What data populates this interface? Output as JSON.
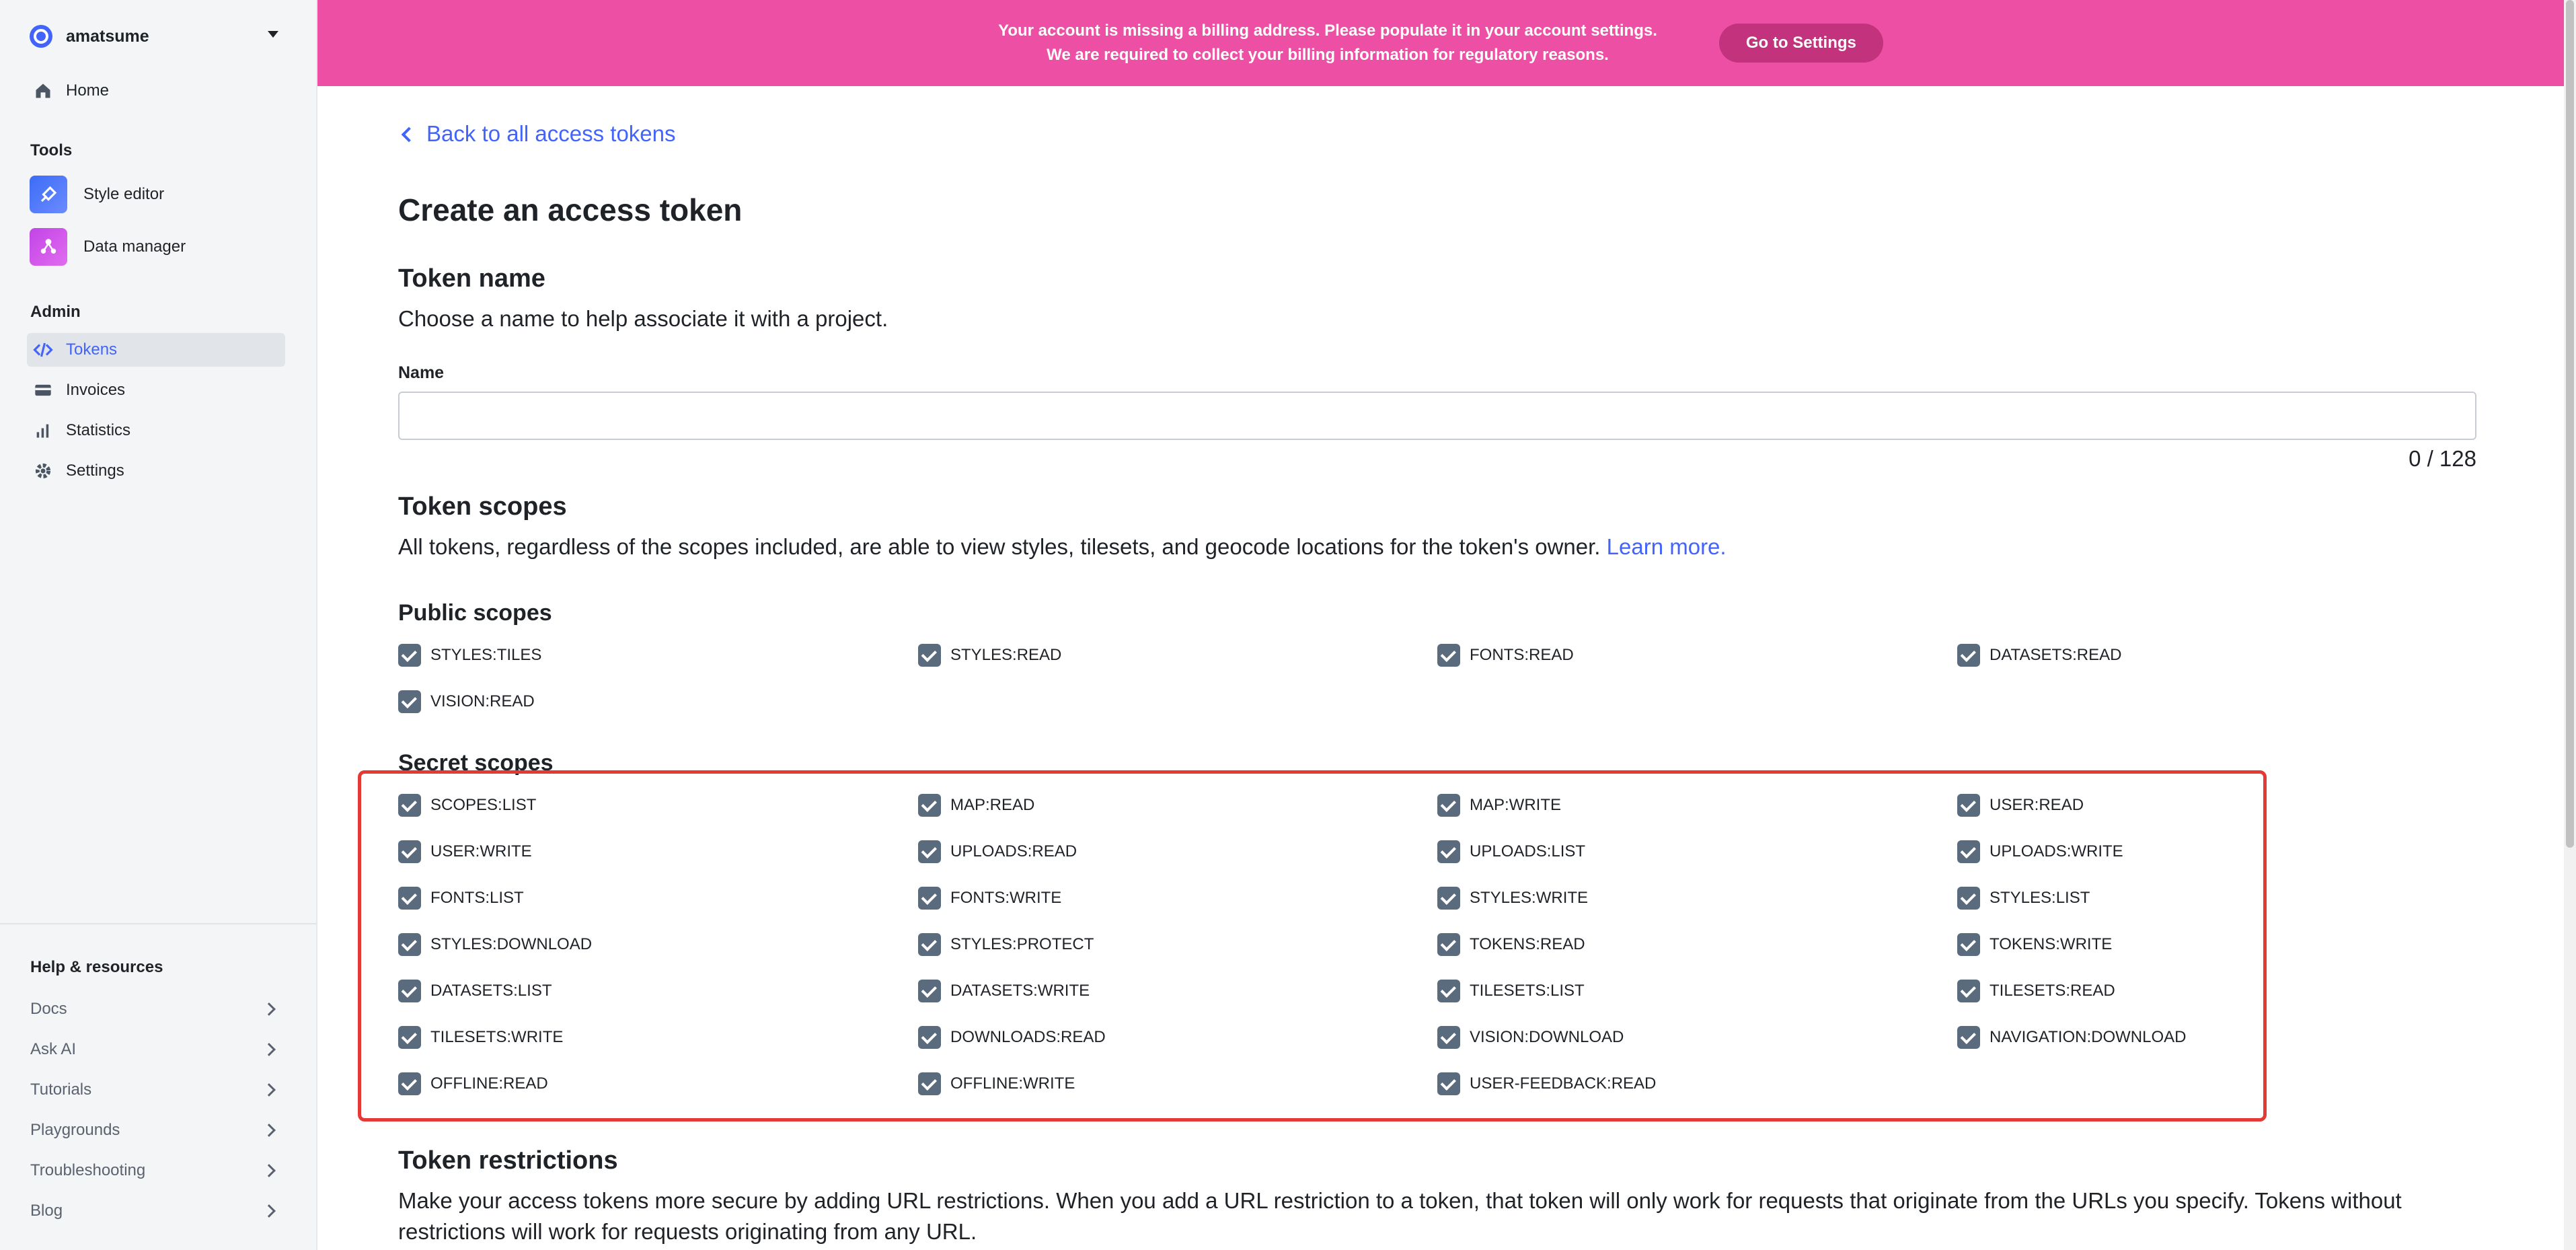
{
  "sidebar": {
    "account_name": "amatsume",
    "home": "Home",
    "tools_heading": "Tools",
    "tools": [
      {
        "label": "Style editor",
        "icon": "paintbrush-icon"
      },
      {
        "label": "Data manager",
        "icon": "database-icon"
      }
    ],
    "admin_heading": "Admin",
    "admin_items": [
      {
        "label": "Tokens",
        "icon": "code-icon",
        "active": true
      },
      {
        "label": "Invoices",
        "icon": "card-icon",
        "active": false
      },
      {
        "label": "Statistics",
        "icon": "bar-chart-icon",
        "active": false
      },
      {
        "label": "Settings",
        "icon": "gear-icon",
        "active": false
      }
    ],
    "help_heading": "Help & resources",
    "help_items": [
      "Docs",
      "Ask AI",
      "Tutorials",
      "Playgrounds",
      "Troubleshooting",
      "Blog"
    ]
  },
  "banner": {
    "line1": "Your account is missing a billing address. Please populate it in your account settings.",
    "line2": "We are required to collect your billing information for regulatory reasons.",
    "button": "Go to Settings",
    "color": "#ed4fa4"
  },
  "main": {
    "back_link": "Back to all access tokens",
    "title": "Create an access token",
    "token_name": {
      "heading": "Token name",
      "description": "Choose a name to help associate it with a project.",
      "field_label": "Name",
      "value": "",
      "counter": "0 / 128"
    },
    "token_scopes": {
      "heading": "Token scopes",
      "description": "All tokens, regardless of the scopes included, are able to view styles, tilesets, and geocode locations for the token's owner.",
      "learn_more": "Learn more.",
      "public_heading": "Public scopes",
      "public": [
        {
          "label": "STYLES:TILES",
          "checked": true
        },
        {
          "label": "STYLES:READ",
          "checked": true
        },
        {
          "label": "FONTS:READ",
          "checked": true
        },
        {
          "label": "DATASETS:READ",
          "checked": true
        },
        {
          "label": "VISION:READ",
          "checked": true
        }
      ],
      "secret_heading": "Secret scopes",
      "secret": [
        {
          "label": "SCOPES:LIST",
          "checked": true
        },
        {
          "label": "MAP:READ",
          "checked": true
        },
        {
          "label": "MAP:WRITE",
          "checked": true
        },
        {
          "label": "USER:READ",
          "checked": true
        },
        {
          "label": "USER:WRITE",
          "checked": true
        },
        {
          "label": "UPLOADS:READ",
          "checked": true
        },
        {
          "label": "UPLOADS:LIST",
          "checked": true
        },
        {
          "label": "UPLOADS:WRITE",
          "checked": true
        },
        {
          "label": "FONTS:LIST",
          "checked": true
        },
        {
          "label": "FONTS:WRITE",
          "checked": true
        },
        {
          "label": "STYLES:WRITE",
          "checked": true
        },
        {
          "label": "STYLES:LIST",
          "checked": true
        },
        {
          "label": "STYLES:DOWNLOAD",
          "checked": true
        },
        {
          "label": "STYLES:PROTECT",
          "checked": true
        },
        {
          "label": "TOKENS:READ",
          "checked": true
        },
        {
          "label": "TOKENS:WRITE",
          "checked": true
        },
        {
          "label": "DATASETS:LIST",
          "checked": true
        },
        {
          "label": "DATASETS:WRITE",
          "checked": true
        },
        {
          "label": "TILESETS:LIST",
          "checked": true
        },
        {
          "label": "TILESETS:READ",
          "checked": true
        },
        {
          "label": "TILESETS:WRITE",
          "checked": true
        },
        {
          "label": "DOWNLOADS:READ",
          "checked": true
        },
        {
          "label": "VISION:DOWNLOAD",
          "checked": true
        },
        {
          "label": "NAVIGATION:DOWNLOAD",
          "checked": true
        },
        {
          "label": "OFFLINE:READ",
          "checked": true
        },
        {
          "label": "OFFLINE:WRITE",
          "checked": true
        },
        {
          "label": "USER-FEEDBACK:READ",
          "checked": true
        }
      ]
    },
    "token_restrictions": {
      "heading": "Token restrictions",
      "description_line1": "Make your access tokens more secure by adding URL restrictions. When you add a URL restriction to a token, that token will only work for requests that originate from the URLs you specify. Tokens without",
      "description_line2": "restrictions will work for requests originating from any URL."
    }
  }
}
